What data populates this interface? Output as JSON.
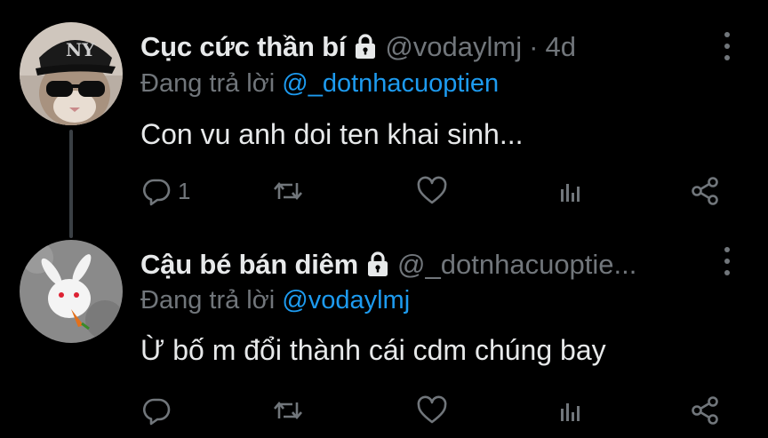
{
  "tweets": [
    {
      "name": "Cục cức thần bí",
      "handle": "@vodaylmj",
      "separator": "·",
      "time": "4d",
      "reply_prefix": "Đang trả lời",
      "reply_to": "@_dotnhacuoptien",
      "text": "Con vu anh doi ten khai sinh...",
      "reply_count": "1",
      "avatar": "cat-with-ny-cap-and-sunglasses"
    },
    {
      "name": "Cậu bé bán diêm",
      "handle": "@_dotnhacuoptie...",
      "separator": "",
      "time": "",
      "reply_prefix": "Đang trả lời",
      "reply_to": "@vodaylmj",
      "text": "Ừ bố m đổi thành cái cdm chúng bay",
      "reply_count": "",
      "avatar": "white-rabbit-plush"
    }
  ],
  "icons": {
    "lock": "lock-icon",
    "more": "more-vertical-icon",
    "reply": "reply-icon",
    "retweet": "retweet-icon",
    "like": "heart-icon",
    "stats": "stats-icon",
    "share": "share-icon"
  },
  "colors": {
    "background": "#000000",
    "text": "#e7e9ea",
    "secondary": "#71767b",
    "accent": "#1d9bf0"
  }
}
